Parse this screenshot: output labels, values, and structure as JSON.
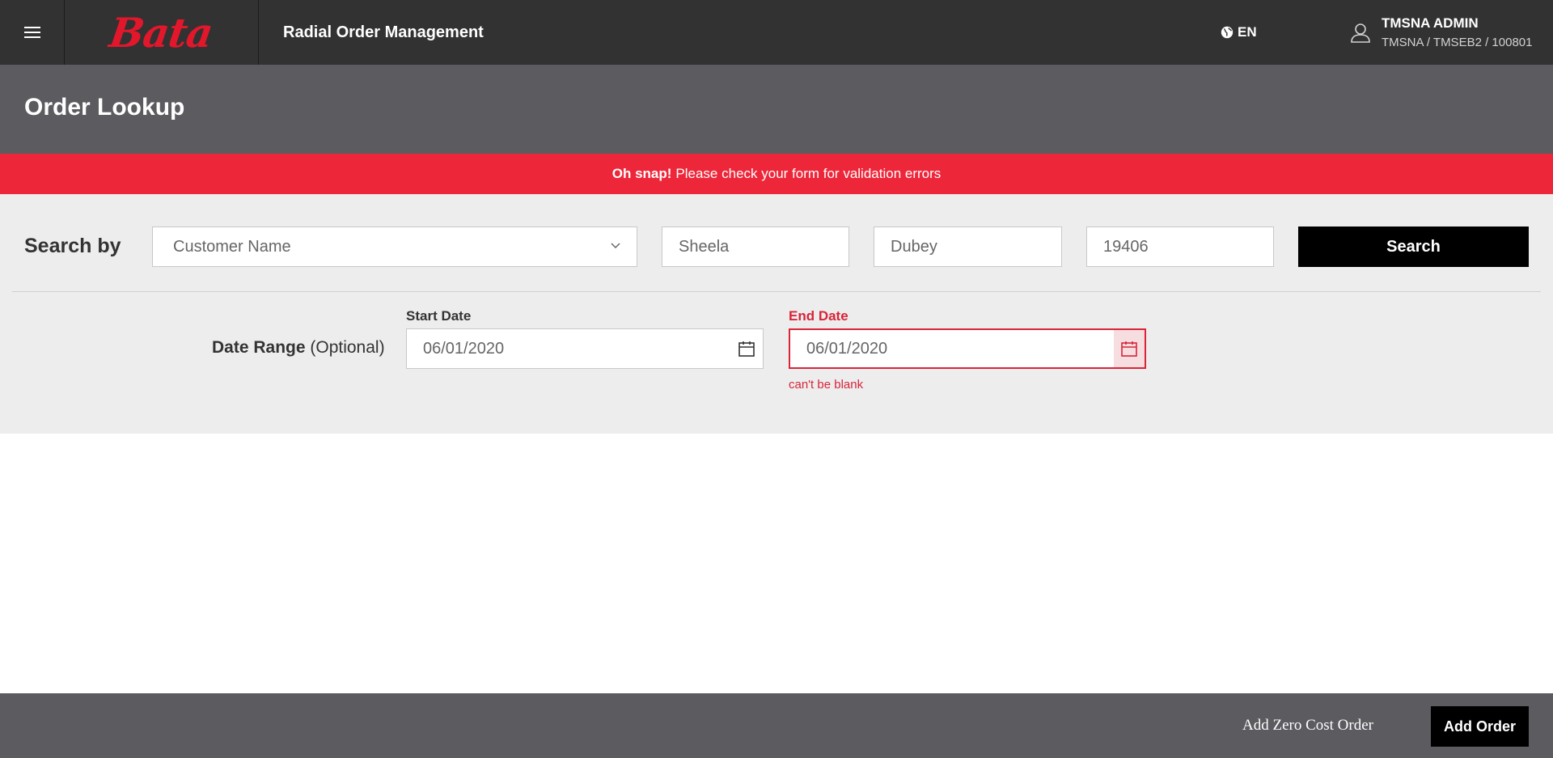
{
  "header": {
    "logo_text": "Bata",
    "app_title": "Radial Order Management",
    "language": "EN",
    "user_name": "TMSNA ADMIN",
    "user_org": "TMSNA / TMSEB2 / 100801"
  },
  "page": {
    "title": "Order Lookup"
  },
  "alert": {
    "strong": "Oh snap!",
    "message": "Please check your form for validation errors"
  },
  "search": {
    "label": "Search by",
    "search_type": "Customer Name",
    "first_name": "Sheela",
    "last_name": "Dubey",
    "zip": "19406",
    "button_label": "Search"
  },
  "date_range": {
    "label": "Date Range",
    "optional": "(Optional)",
    "start_label": "Start Date",
    "start_value": "06/01/2020",
    "end_label": "End Date",
    "end_value": "06/01/2020",
    "end_error": "can't be blank"
  },
  "footer": {
    "zero_cost_label": "Add Zero Cost Order",
    "add_order_label": "Add Order"
  },
  "colors": {
    "accent": "#e3172b",
    "alert_bg": "#ee2639",
    "topbar_bg": "#323232",
    "header_bg": "#5b5b60"
  },
  "icons": [
    "hamburger-menu-icon",
    "globe-icon",
    "user-icon",
    "chevron-down-icon",
    "calendar-icon"
  ]
}
